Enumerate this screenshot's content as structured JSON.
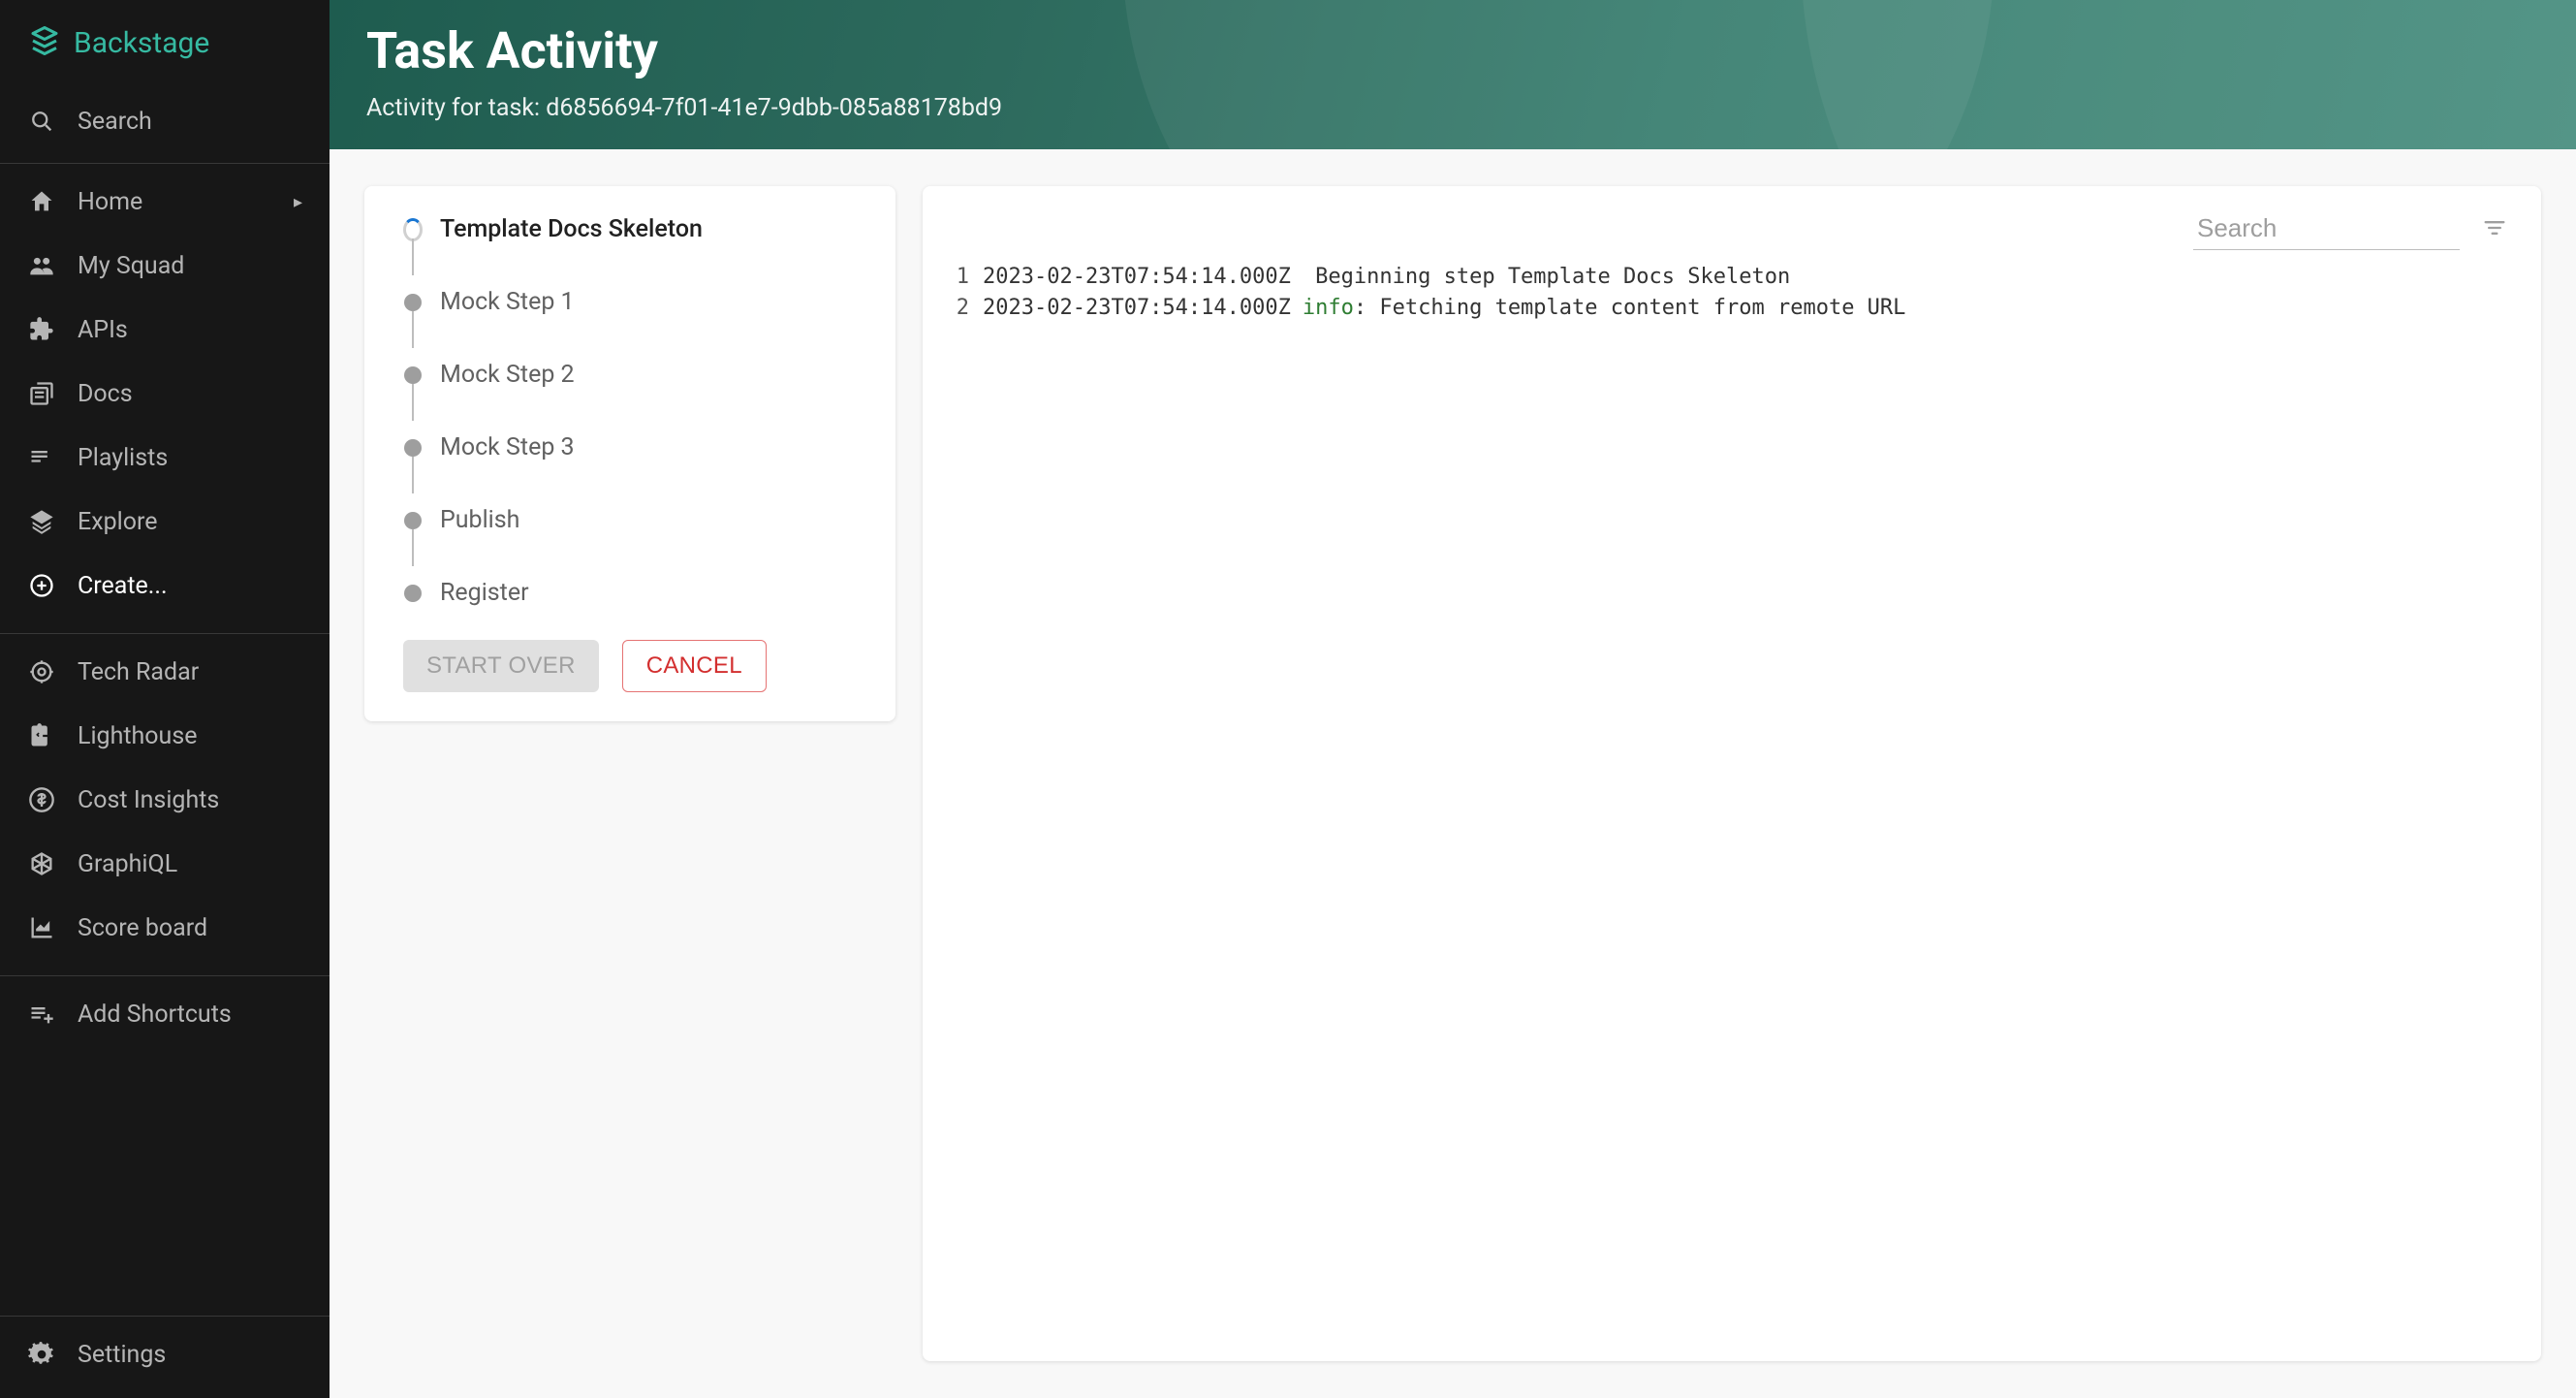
{
  "brand": "Backstage",
  "search_label": "Search",
  "nav": {
    "group1": [
      {
        "label": "Home",
        "icon": "home",
        "expandable": true
      },
      {
        "label": "My Squad",
        "icon": "people"
      },
      {
        "label": "APIs",
        "icon": "extension"
      },
      {
        "label": "Docs",
        "icon": "library-books"
      },
      {
        "label": "Playlists",
        "icon": "playlist"
      },
      {
        "label": "Explore",
        "icon": "layers"
      },
      {
        "label": "Create...",
        "icon": "plus-circle",
        "active": true
      }
    ],
    "group2": [
      {
        "label": "Tech Radar",
        "icon": "target"
      },
      {
        "label": "Lighthouse",
        "icon": "assignment"
      },
      {
        "label": "Cost Insights",
        "icon": "dollar"
      },
      {
        "label": "GraphiQL",
        "icon": "graphql"
      },
      {
        "label": "Score board",
        "icon": "chart"
      }
    ],
    "group3": [
      {
        "label": "Add Shortcuts",
        "icon": "playlist-add"
      }
    ],
    "bottom": {
      "label": "Settings",
      "icon": "gear"
    }
  },
  "header": {
    "title": "Task Activity",
    "subtitle": "Activity for task: d6856694-7f01-41e7-9dbb-085a88178bd9"
  },
  "steps": [
    {
      "label": "Template Docs Skeleton",
      "state": "running"
    },
    {
      "label": "Mock Step 1",
      "state": "pending"
    },
    {
      "label": "Mock Step 2",
      "state": "pending"
    },
    {
      "label": "Mock Step 3",
      "state": "pending"
    },
    {
      "label": "Publish",
      "state": "pending"
    },
    {
      "label": "Register",
      "state": "pending"
    }
  ],
  "buttons": {
    "start_over": "START OVER",
    "cancel": "CANCEL"
  },
  "log": {
    "search_placeholder": "Search",
    "lines": [
      {
        "n": "1",
        "ts": "2023-02-23T07:54:14.000Z",
        "level": "",
        "msg": "Beginning step Template Docs Skeleton"
      },
      {
        "n": "2",
        "ts": "2023-02-23T07:54:14.000Z",
        "level": "info",
        "msg": ": Fetching template content from remote URL"
      }
    ]
  }
}
